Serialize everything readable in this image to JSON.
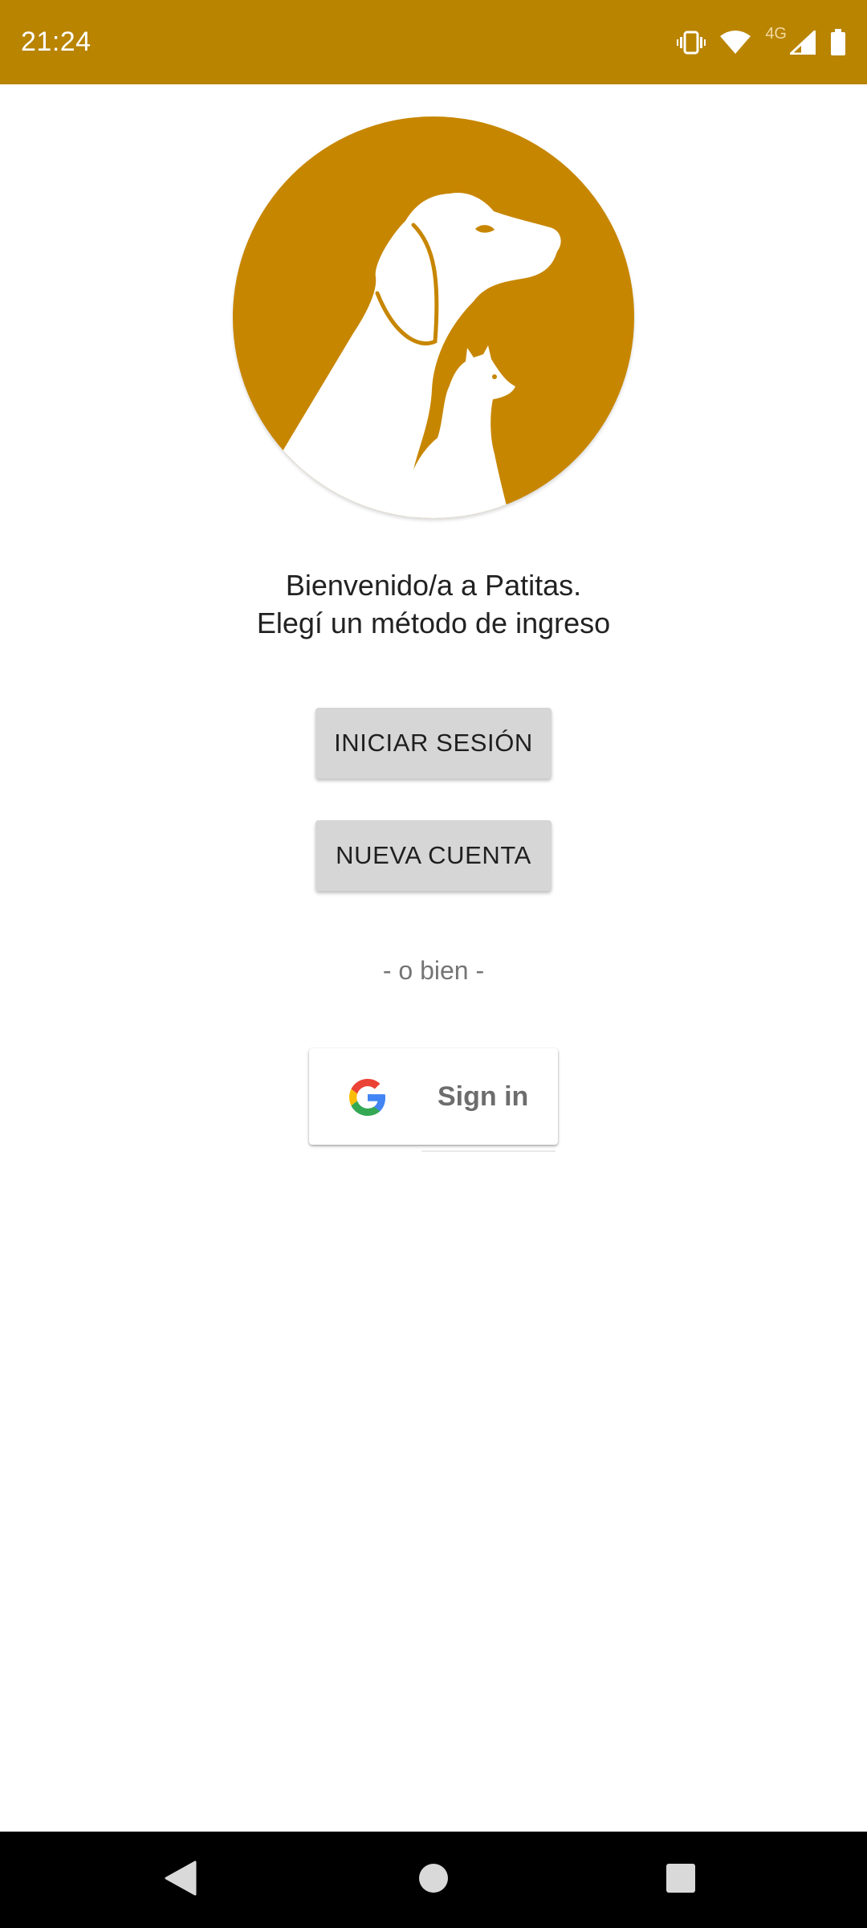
{
  "status_bar": {
    "time": "21:24",
    "network_label": "4G",
    "icons": [
      "vibrate-icon",
      "wifi-icon",
      "signal-icon",
      "battery-icon"
    ]
  },
  "logo": {
    "icon": "dog-and-cat-logo",
    "color": "#c78600"
  },
  "welcome": {
    "line1": "Bienvenido/a a Patitas.",
    "line2": "Elegí un método de ingreso"
  },
  "buttons": {
    "login_label": "INICIAR SESIÓN",
    "new_account_label": "NUEVA CUENTA"
  },
  "separator_text": "- o bien -",
  "google": {
    "label": "Sign in",
    "icon": "google-icon"
  },
  "nav": {
    "icons": [
      "back-icon",
      "home-icon",
      "recents-icon"
    ]
  },
  "colors": {
    "accent": "#b98400",
    "button_bg": "#d6d6d6",
    "nav_bg": "#000000"
  }
}
